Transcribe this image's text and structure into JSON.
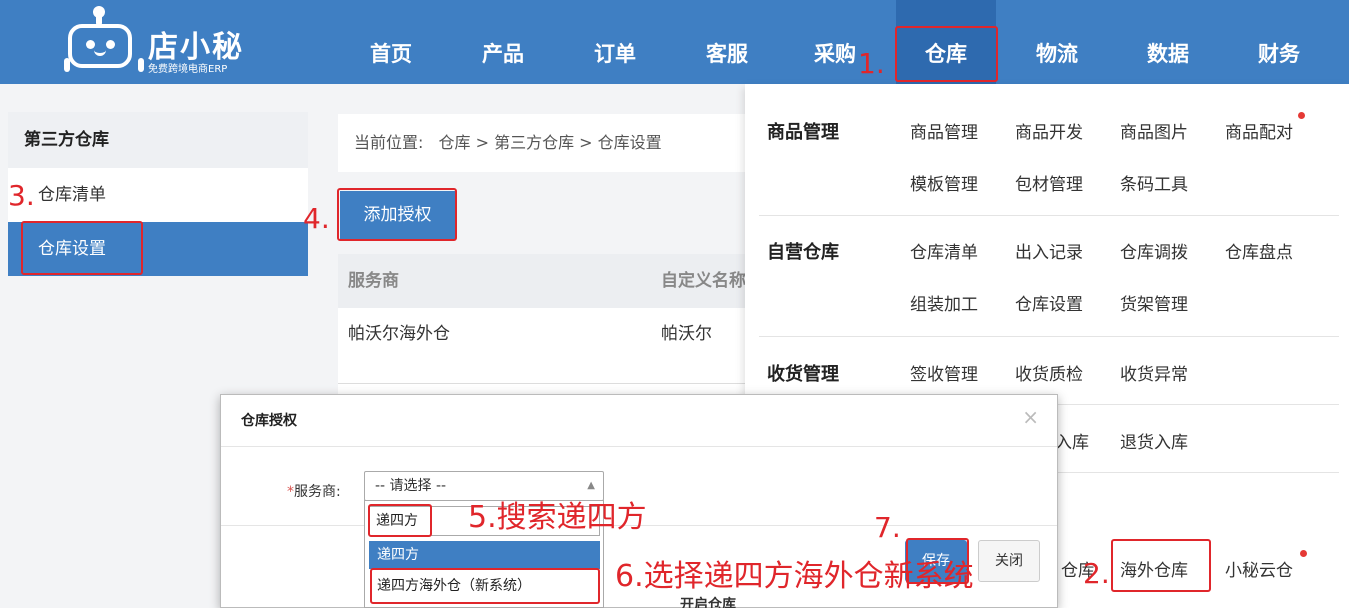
{
  "app": {
    "logo_name": "店小秘",
    "logo_tagline": "免费跨境电商ERP"
  },
  "nav": {
    "items": [
      "首页",
      "产品",
      "订单",
      "客服",
      "采购",
      "仓库",
      "物流",
      "数据",
      "财务"
    ],
    "active": "仓库"
  },
  "sidebar": {
    "title": "第三方仓库",
    "items": [
      "仓库清单",
      "仓库设置"
    ],
    "active": "仓库设置"
  },
  "breadcrumb": {
    "label": "当前位置:",
    "path": "仓库 > 第三方仓库 > 仓库设置"
  },
  "main": {
    "add_button": "添加授权",
    "table": {
      "headers": [
        "服务商",
        "自定义名称"
      ],
      "rows": [
        [
          "帕沃尔海外仓",
          "帕沃尔"
        ]
      ]
    }
  },
  "mega_menu": {
    "groups": [
      {
        "title": "商品管理",
        "links": [
          "商品管理",
          "商品开发",
          "商品图片",
          "商品配对",
          "模板管理",
          "包材管理",
          "条码工具"
        ]
      },
      {
        "title": "自营仓库",
        "links": [
          "仓库清单",
          "出入记录",
          "仓库调拨",
          "仓库盘点",
          "组装加工",
          "仓库设置",
          "货架管理"
        ]
      },
      {
        "title": "收货管理",
        "links": [
          "签收管理",
          "收货质检",
          "收货异常"
        ]
      },
      {
        "title": "",
        "links": [
          "入库",
          "退货入库"
        ]
      },
      {
        "title": "",
        "links": [
          "仓库",
          "海外仓库",
          "小秘云仓"
        ]
      }
    ]
  },
  "modal": {
    "title": "仓库授权",
    "field_label": "服务商:",
    "select_placeholder": "-- 请选择 --",
    "search_value": "递四方",
    "options": [
      "递四方",
      "递四方海外仓（新系统）"
    ],
    "save": "保存",
    "close": "关闭",
    "under_text": "开启仓库"
  },
  "annotations": {
    "step1": "1.",
    "step2": "2.",
    "step3": "3.",
    "step4": "4.",
    "step5": "5.搜索递四方",
    "step6": "6.选择递四方海外仓新系统",
    "step7": "7."
  },
  "colors": {
    "primary": "#3f7fc3",
    "annotation_red": "#e0262b",
    "new_dot": "#e53935"
  }
}
